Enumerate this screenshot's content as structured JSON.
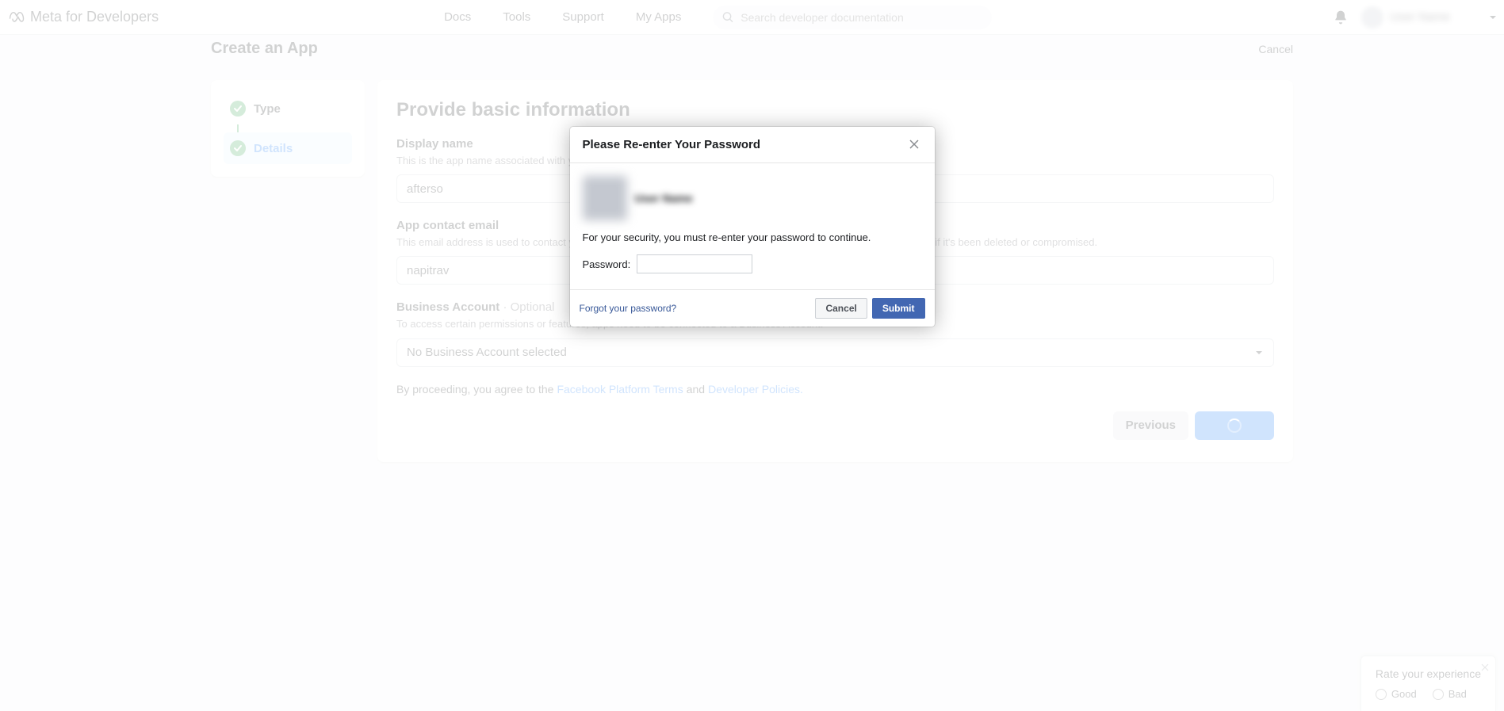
{
  "nav": {
    "logo_text": "Meta for Developers",
    "links": {
      "docs": "Docs",
      "tools": "Tools",
      "support": "Support",
      "my_apps": "My Apps"
    },
    "search_placeholder": "Search developer documentation",
    "user_name": "User Name"
  },
  "page": {
    "breadcrumb": "Create an App",
    "cancel_label": "Cancel"
  },
  "steps": {
    "type": "Type",
    "details": "Details"
  },
  "form": {
    "title": "Provide basic information",
    "display_name": {
      "label": "Display name",
      "help": "This is the app name associated with your app ID. You can change this later.",
      "value": "afterso"
    },
    "contact_email": {
      "label": "App contact email",
      "help": "This email address is used to contact you about potential policy violations, app restrictions or steps to recover the app if it's been deleted or compromised.",
      "value": "napitrav"
    },
    "business": {
      "label": "Business Account",
      "optional": " · Optional",
      "help": "To access certain permissions or features, apps need to be connected to a Business Account.",
      "selected": "No Business Account selected"
    },
    "agreement": {
      "prefix": "By proceeding, you agree to the ",
      "platform_terms": "Facebook Platform Terms",
      "and": " and ",
      "dev_policies": "Developer Policies."
    },
    "previous_label": "Previous"
  },
  "modal": {
    "title": "Please Re-enter Your Password",
    "user_name": "User Name",
    "body_text": "For your security, you must re-enter your password to continue.",
    "password_label": "Password:",
    "forgot_link": "Forgot your password?",
    "cancel_label": "Cancel",
    "submit_label": "Submit"
  },
  "feedback": {
    "title": "Rate your experience",
    "good": "Good",
    "bad": "Bad"
  }
}
